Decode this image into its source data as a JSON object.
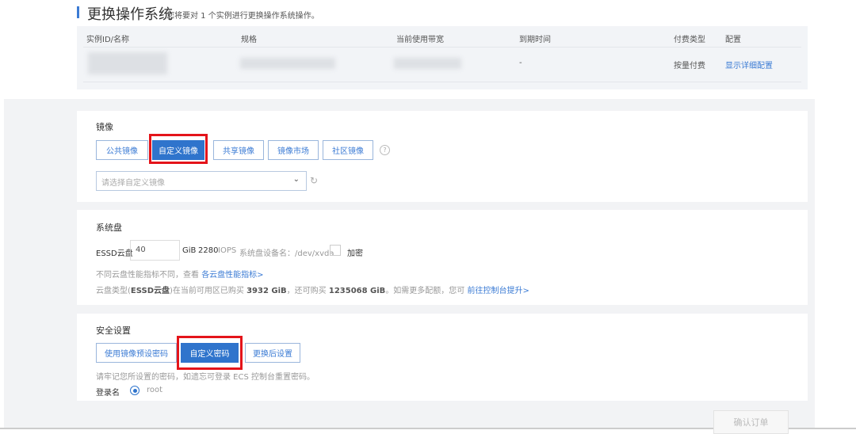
{
  "header": {
    "title": "更换操作系统",
    "subtitle": "您将要对 1 个实例进行更换操作系统操作。"
  },
  "table": {
    "columns": [
      "实例ID/名称",
      "规格",
      "当前使用带宽",
      "到期时间",
      "付费类型",
      "配置"
    ],
    "row": {
      "expire": "-",
      "billing": "按量付费",
      "config_link": "显示详细配置"
    }
  },
  "image": {
    "label": "镜像",
    "tabs": [
      "公共镜像",
      "自定义镜像",
      "共享镜像",
      "镜像市场",
      "社区镜像"
    ],
    "active_tab": "自定义镜像",
    "select_placeholder": "请选择自定义镜像"
  },
  "disk": {
    "label": "系统盘",
    "type": "ESSD云盘",
    "size": "40",
    "unit": "GiB",
    "iops_value": "2280",
    "iops_label": "IOPS",
    "device_label": "系统盘设备名：/dev/xvda",
    "encrypt_label": "加密",
    "hint1": "不同云盘性能指标不同，查看",
    "hint1_link": "各云盘性能指标>",
    "hint2_a": "云盘类型(",
    "hint2_type": "ESSD云盘",
    "hint2_b": ")在当前可用区已购买",
    "hint2_bought": "3932 GiB",
    "hint2_c": "，还可购买",
    "hint2_remaining": "1235068 GiB",
    "hint2_d": "。如需更多配额，您可",
    "hint2_link": "前往控制台提升>"
  },
  "security": {
    "label": "安全设置",
    "tabs": [
      "使用镜像预设密码",
      "自定义密码",
      "更换后设置"
    ],
    "active_tab": "自定义密码",
    "hint": "请牢记您所设置的密码，如遗忘可登录 ECS 控制台重置密码。",
    "login_label": "登录名",
    "login_value": "root"
  },
  "footer": {
    "confirm": "确认订单"
  },
  "colors": {
    "accent": "#2f74cc",
    "highlight": "#e4141a"
  }
}
